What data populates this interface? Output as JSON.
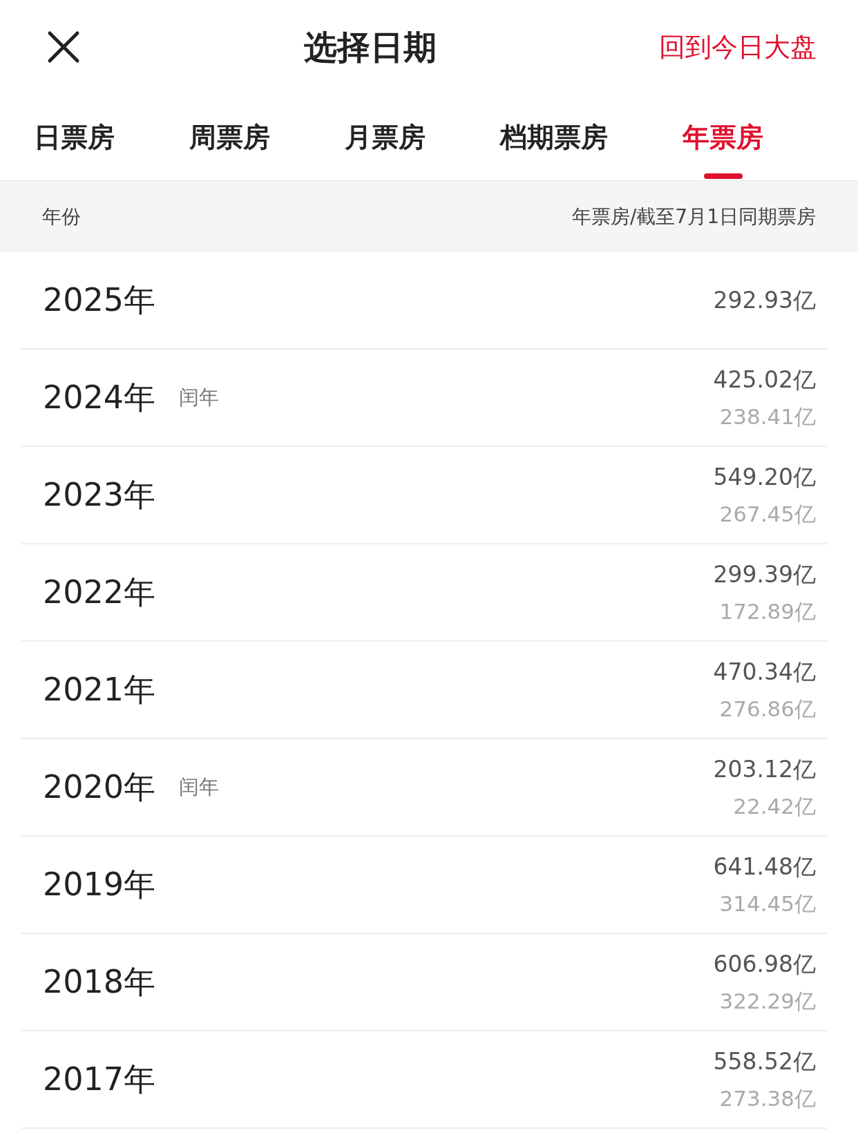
{
  "header": {
    "title": "选择日期",
    "action": "回到今日大盘"
  },
  "tabs": [
    {
      "label": "日票房",
      "selected": false
    },
    {
      "label": "周票房",
      "selected": false
    },
    {
      "label": "月票房",
      "selected": false
    },
    {
      "label": "档期票房",
      "selected": false
    },
    {
      "label": "年票房",
      "selected": true
    }
  ],
  "table": {
    "columns": [
      "年份",
      "年票房/截至7月1日同期票房"
    ],
    "rows": [
      {
        "year": "2025年",
        "total": "292.93亿"
      },
      {
        "year": "2024年",
        "tag": "闰年",
        "total": "425.02亿",
        "same_period": "238.41亿"
      },
      {
        "year": "2023年",
        "total": "549.20亿",
        "same_period": "267.45亿"
      },
      {
        "year": "2022年",
        "total": "299.39亿",
        "same_period": "172.89亿"
      },
      {
        "year": "2021年",
        "total": "470.34亿",
        "same_period": "276.86亿"
      },
      {
        "year": "2020年",
        "tag": "闰年",
        "total": "203.12亿",
        "same_period": "22.42亿"
      },
      {
        "year": "2019年",
        "total": "641.48亿",
        "same_period": "314.45亿"
      },
      {
        "year": "2018年",
        "total": "606.98亿",
        "same_period": "322.29亿"
      },
      {
        "year": "2017年",
        "total": "558.52亿",
        "same_period": "273.38亿"
      }
    ]
  }
}
